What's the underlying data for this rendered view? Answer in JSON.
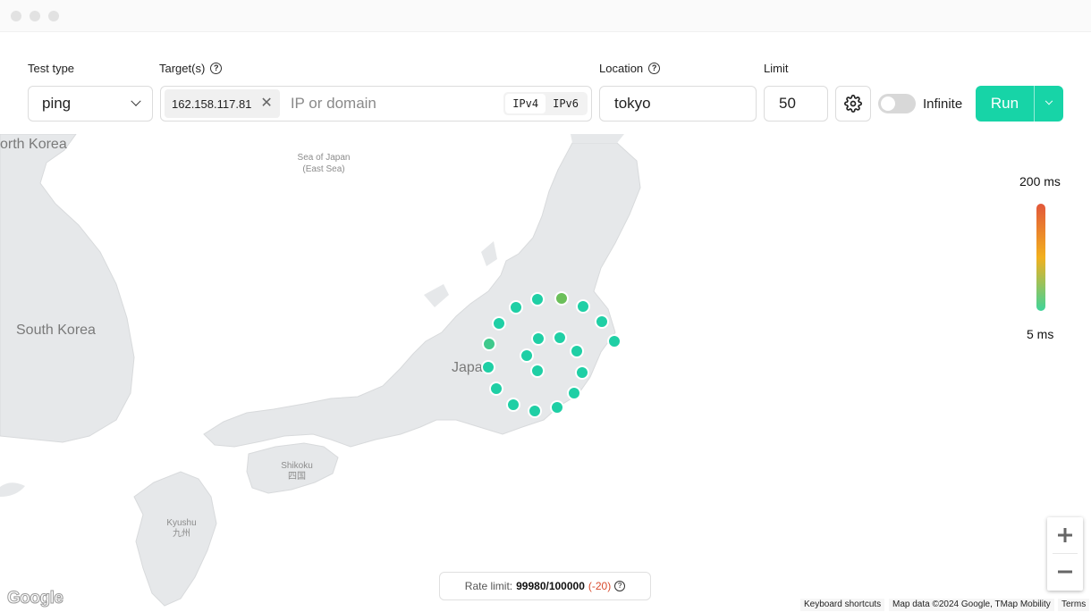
{
  "toolbar": {
    "test_type": {
      "label": "Test type",
      "value": "ping"
    },
    "targets": {
      "label": "Target(s)",
      "chip": "162.158.117.81",
      "placeholder": "IP or domain",
      "ip_versions": [
        "IPv4",
        "IPv6"
      ]
    },
    "location": {
      "label": "Location",
      "value": "tokyo"
    },
    "limit": {
      "label": "Limit",
      "value": "50"
    },
    "infinite_label": "Infinite",
    "infinite_on": false,
    "run_label": "Run"
  },
  "map": {
    "labels": {
      "north_korea": "orth Korea",
      "south_korea": "South Korea",
      "japan": "Japa",
      "sea_of_japan": "Sea of Japan",
      "east_sea": "(East Sea)",
      "shikoku": "Shikoku",
      "shikoku_kanji": "四国",
      "kyushu": "Kyushu",
      "kyushu_kanji": "九州"
    },
    "probe_color": "#1fcfa5",
    "probe_color_slow": "#6bbf5a"
  },
  "legend": {
    "max": "200 ms",
    "min": "5 ms",
    "colors": [
      "#e2573a",
      "#f2b01e",
      "#3ed49a"
    ]
  },
  "rate_limit": {
    "label": "Rate limit:",
    "value": "99980/100000",
    "delta": "(-20)"
  },
  "attribution": {
    "google": "Google",
    "shortcuts": "Keyboard shortcuts",
    "map_data": "Map data ©2024 Google, TMap Mobility",
    "terms": "Terms"
  }
}
